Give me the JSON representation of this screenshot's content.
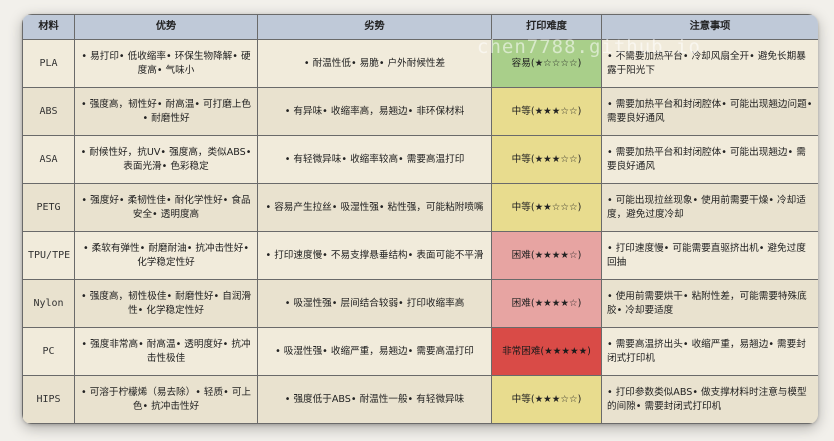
{
  "headers": {
    "material": "材料",
    "advantages": "优势",
    "disadvantages": "劣势",
    "difficulty": "打印难度",
    "notes": "注意事项"
  },
  "watermark": "chen7788.github.io",
  "rows": [
    {
      "material": "PLA",
      "advantages": "• 易打印• 低收缩率• 环保生物降解• 硬度高• 气味小",
      "disadvantages": "• 耐温性低• 易脆• 户外耐候性差",
      "difficulty": "容易(★☆☆☆☆)",
      "level": "easy",
      "notes": "• 不需要加热平台• 冷却风扇全开• 避免长期暴露于阳光下"
    },
    {
      "material": "ABS",
      "advantages": "• 强度高，韧性好• 耐高温• 可打磨上色• 耐磨性好",
      "disadvantages": "• 有异味• 收缩率高，易翘边• 非环保材料",
      "difficulty": "中等(★★★☆☆)",
      "level": "medium",
      "notes": "• 需要加热平台和封闭腔体• 可能出现翘边问题• 需要良好通风"
    },
    {
      "material": "ASA",
      "advantages": "• 耐候性好，抗UV• 强度高，类似ABS• 表面光滑• 色彩稳定",
      "disadvantages": "• 有轻微异味• 收缩率较高• 需要高温打印",
      "difficulty": "中等(★★★☆☆)",
      "level": "medium",
      "notes": "• 需要加热平台和封闭腔体• 可能出现翘边• 需要良好通风"
    },
    {
      "material": "PETG",
      "advantages": "• 强度好• 柔韧性佳• 耐化学性好• 食品安全• 透明度高",
      "disadvantages": "• 容易产生拉丝• 吸湿性强• 粘性强，可能粘附喷嘴",
      "difficulty": "中等(★★☆☆☆)",
      "level": "medium",
      "notes": "• 可能出现拉丝现象• 使用前需要干燥• 冷却适度，避免过度冷却"
    },
    {
      "material": "TPU/TPE",
      "advantages": "• 柔软有弹性• 耐磨耐油• 抗冲击性好• 化学稳定性好",
      "disadvantages": "• 打印速度慢• 不易支撑悬垂结构• 表面可能不平滑",
      "difficulty": "困难(★★★★☆)",
      "level": "hard",
      "notes": "• 打印速度慢• 可能需要直驱挤出机• 避免过度回抽"
    },
    {
      "material": "Nylon",
      "advantages": "• 强度高，韧性极佳• 耐磨性好• 自润滑性• 化学稳定性好",
      "disadvantages": "• 吸湿性强• 层间结合较弱• 打印收缩率高",
      "difficulty": "困难(★★★★☆)",
      "level": "hard",
      "notes": "• 使用前需要烘干• 粘附性差，可能需要特殊底胶• 冷却要适度"
    },
    {
      "material": "PC",
      "advantages": "• 强度非常高• 耐高温• 透明度好• 抗冲击性极佳",
      "disadvantages": "• 吸湿性强• 收缩严重，易翘边• 需要高温打印",
      "difficulty": "非常困难(★★★★★)",
      "level": "veryhard",
      "notes": "• 需要高温挤出头• 收缩严重，易翘边• 需要封闭式打印机"
    },
    {
      "material": "HIPS",
      "advantages": "• 可溶于柠檬烯（易去除）• 轻质• 可上色• 抗冲击性好",
      "disadvantages": "• 强度低于ABS• 耐温性一般• 有轻微异味",
      "difficulty": "中等(★★★☆☆)",
      "level": "medium",
      "notes": "• 打印参数类似ABS• 做支撑材料时注意与模型的间隙• 需要封闭式打印机"
    }
  ]
}
